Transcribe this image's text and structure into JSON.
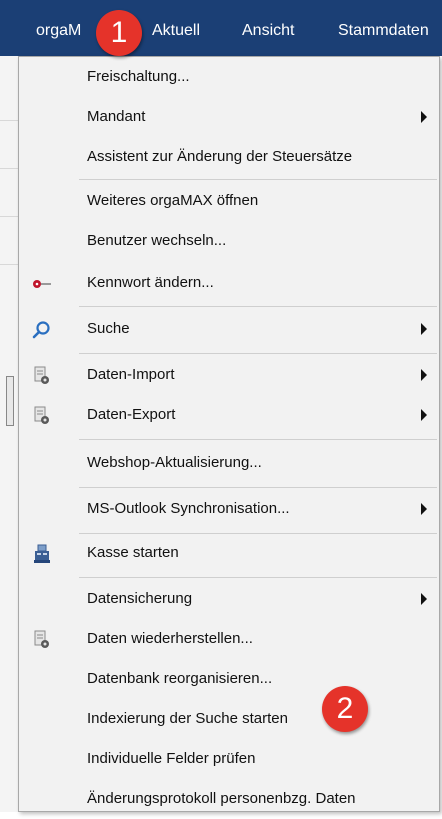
{
  "menubar": {
    "app_label": "orgaM",
    "items": [
      "Aktuell",
      "Ansicht",
      "Stammdaten"
    ]
  },
  "badges": [
    "1",
    "2"
  ],
  "menu": {
    "items": [
      {
        "label": "Freischaltung...",
        "submenu": false,
        "icon": null
      },
      {
        "label": "Mandant",
        "submenu": true,
        "icon": null
      },
      {
        "label": "Assistent zur Änderung der Steuersätze",
        "submenu": false,
        "icon": null
      },
      {
        "label": "Weiteres orgaMAX öffnen",
        "submenu": false,
        "icon": null
      },
      {
        "label": "Benutzer wechseln...",
        "submenu": false,
        "icon": null
      },
      {
        "label": "Kennwort ändern...",
        "submenu": false,
        "icon": "key-icon"
      },
      {
        "label": "Suche",
        "submenu": true,
        "icon": "search-icon"
      },
      {
        "label": "Daten-Import",
        "submenu": true,
        "icon": "document-gear-icon"
      },
      {
        "label": "Daten-Export",
        "submenu": true,
        "icon": "document-gear-icon"
      },
      {
        "label": "Webshop-Aktualisierung...",
        "submenu": false,
        "icon": null
      },
      {
        "label": "MS-Outlook Synchronisation...",
        "submenu": true,
        "icon": null
      },
      {
        "label": "Kasse starten",
        "submenu": false,
        "icon": "cash-register-icon"
      },
      {
        "label": "Datensicherung",
        "submenu": true,
        "icon": null
      },
      {
        "label": "Daten wiederherstellen...",
        "submenu": false,
        "icon": "document-gear-icon"
      },
      {
        "label": "Datenbank reorganisieren...",
        "submenu": false,
        "icon": null
      },
      {
        "label": "Indexierung der Suche starten",
        "submenu": false,
        "icon": null
      },
      {
        "label": "Individuelle Felder prüfen",
        "submenu": false,
        "icon": null
      },
      {
        "label": "Änderungsprotokoll personenbzg. Daten",
        "submenu": false,
        "icon": null
      }
    ]
  },
  "colors": {
    "menubar_bg": "#1b3f75",
    "badge_red": "#e5332a",
    "menu_bg": "#f2f2f2"
  }
}
